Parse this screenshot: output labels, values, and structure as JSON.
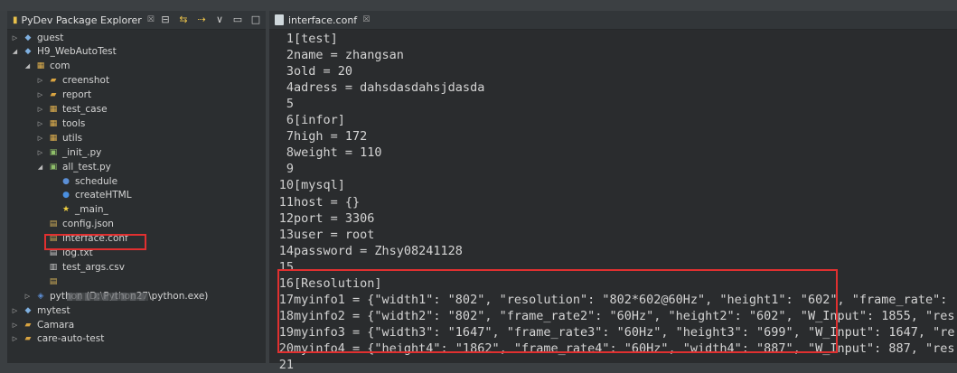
{
  "explorer": {
    "tab_title": "PyDev Package Explorer",
    "tab_close": "☒",
    "items": [
      {
        "label": "guest",
        "indent": 0,
        "arrow": "▷",
        "icon": "project-icon"
      },
      {
        "label": "H9_WebAutoTest",
        "indent": 0,
        "arrow": "◢",
        "icon": "project-icon"
      },
      {
        "label": "com",
        "indent": 1,
        "arrow": "◢",
        "icon": "package-icon"
      },
      {
        "label": "creenshot",
        "indent": 2,
        "arrow": "▷",
        "icon": "folder-icon"
      },
      {
        "label": "report",
        "indent": 2,
        "arrow": "▷",
        "icon": "folder-icon"
      },
      {
        "label": "test_case",
        "indent": 2,
        "arrow": "▷",
        "icon": "package-icon"
      },
      {
        "label": "tools",
        "indent": 2,
        "arrow": "▷",
        "icon": "package-icon"
      },
      {
        "label": "utils",
        "indent": 2,
        "arrow": "▷",
        "icon": "package-icon"
      },
      {
        "label": "_init_.py",
        "indent": 2,
        "arrow": "▷",
        "icon": "python-file-icon"
      },
      {
        "label": "all_test.py",
        "indent": 2,
        "arrow": "◢",
        "icon": "python-file-icon"
      },
      {
        "label": "schedule",
        "indent": 3,
        "arrow": "",
        "icon": "variable-icon"
      },
      {
        "label": "createHTML",
        "indent": 3,
        "arrow": "",
        "icon": "function-icon"
      },
      {
        "label": "_main_",
        "indent": 3,
        "arrow": "",
        "icon": "star-icon"
      },
      {
        "label": "config.json",
        "indent": 2,
        "arrow": "",
        "icon": "file-icon"
      },
      {
        "label": "interface.conf",
        "indent": 2,
        "arrow": "",
        "icon": "file-icon"
      },
      {
        "label": "log.txt",
        "indent": 2,
        "arrow": "",
        "icon": "text-file-icon"
      },
      {
        "label": "test_args.csv",
        "indent": 2,
        "arrow": "",
        "icon": "csv-file-icon"
      },
      {
        "label": "",
        "indent": 2,
        "arrow": "",
        "icon": "file-icon"
      },
      {
        "label": "python  (D:\\Python27\\python.exe)",
        "indent": 1,
        "arrow": "▷",
        "icon": "python-icon"
      },
      {
        "label": "mytest",
        "indent": 0,
        "arrow": "▷",
        "icon": "project-icon"
      },
      {
        "label": "Camara",
        "indent": 0,
        "arrow": "▷",
        "icon": "folder-icon"
      },
      {
        "label": "care-auto-test",
        "indent": 0,
        "arrow": "▷",
        "icon": "folder-icon"
      }
    ]
  },
  "editor": {
    "tab_title": "interface.conf",
    "tab_close": "☒",
    "lines": [
      {
        "n": "1",
        "t": "[test]"
      },
      {
        "n": "2",
        "t": "name = zhangsan"
      },
      {
        "n": "3",
        "t": "old = 20"
      },
      {
        "n": "4",
        "t": "adress = dahsdasdahsjdasda"
      },
      {
        "n": "5",
        "t": ""
      },
      {
        "n": "6",
        "t": "[infor]"
      },
      {
        "n": "7",
        "t": "high = 172"
      },
      {
        "n": "8",
        "t": "weight = 110"
      },
      {
        "n": "9",
        "t": ""
      },
      {
        "n": "10",
        "t": "[mysql]"
      },
      {
        "n": "11",
        "t": "host = {}"
      },
      {
        "n": "12",
        "t": "port = 3306"
      },
      {
        "n": "13",
        "t": "user = root"
      },
      {
        "n": "14",
        "t": "password = Zhsy08241128"
      },
      {
        "n": "15",
        "t": ""
      },
      {
        "n": "16",
        "t": "[Resolution]"
      },
      {
        "n": "17",
        "t": "myinfo1 = {\"width1\": \"802\", \"resolution\": \"802*602@60Hz\", \"height1\": \"602\", \"frame_rate\":"
      },
      {
        "n": "18",
        "t": "myinfo2 = {\"width2\": \"802\", \"frame_rate2\": \"60Hz\", \"height2\": \"602\", \"W_Input\": 1855, \"res"
      },
      {
        "n": "19",
        "t": "myinfo3 = {\"width3\": \"1647\", \"frame_rate3\": \"60Hz\", \"height3\": \"699\", \"W_Input\": 1647, \"re"
      },
      {
        "n": "20",
        "t": "myinfo4 = {\"height4\": \"1862\", \"frame_rate4\": \"60Hz\", \"width4\": \"887\", \"W_Input\": 887, \"res"
      },
      {
        "n": "21",
        "t": ""
      }
    ]
  }
}
